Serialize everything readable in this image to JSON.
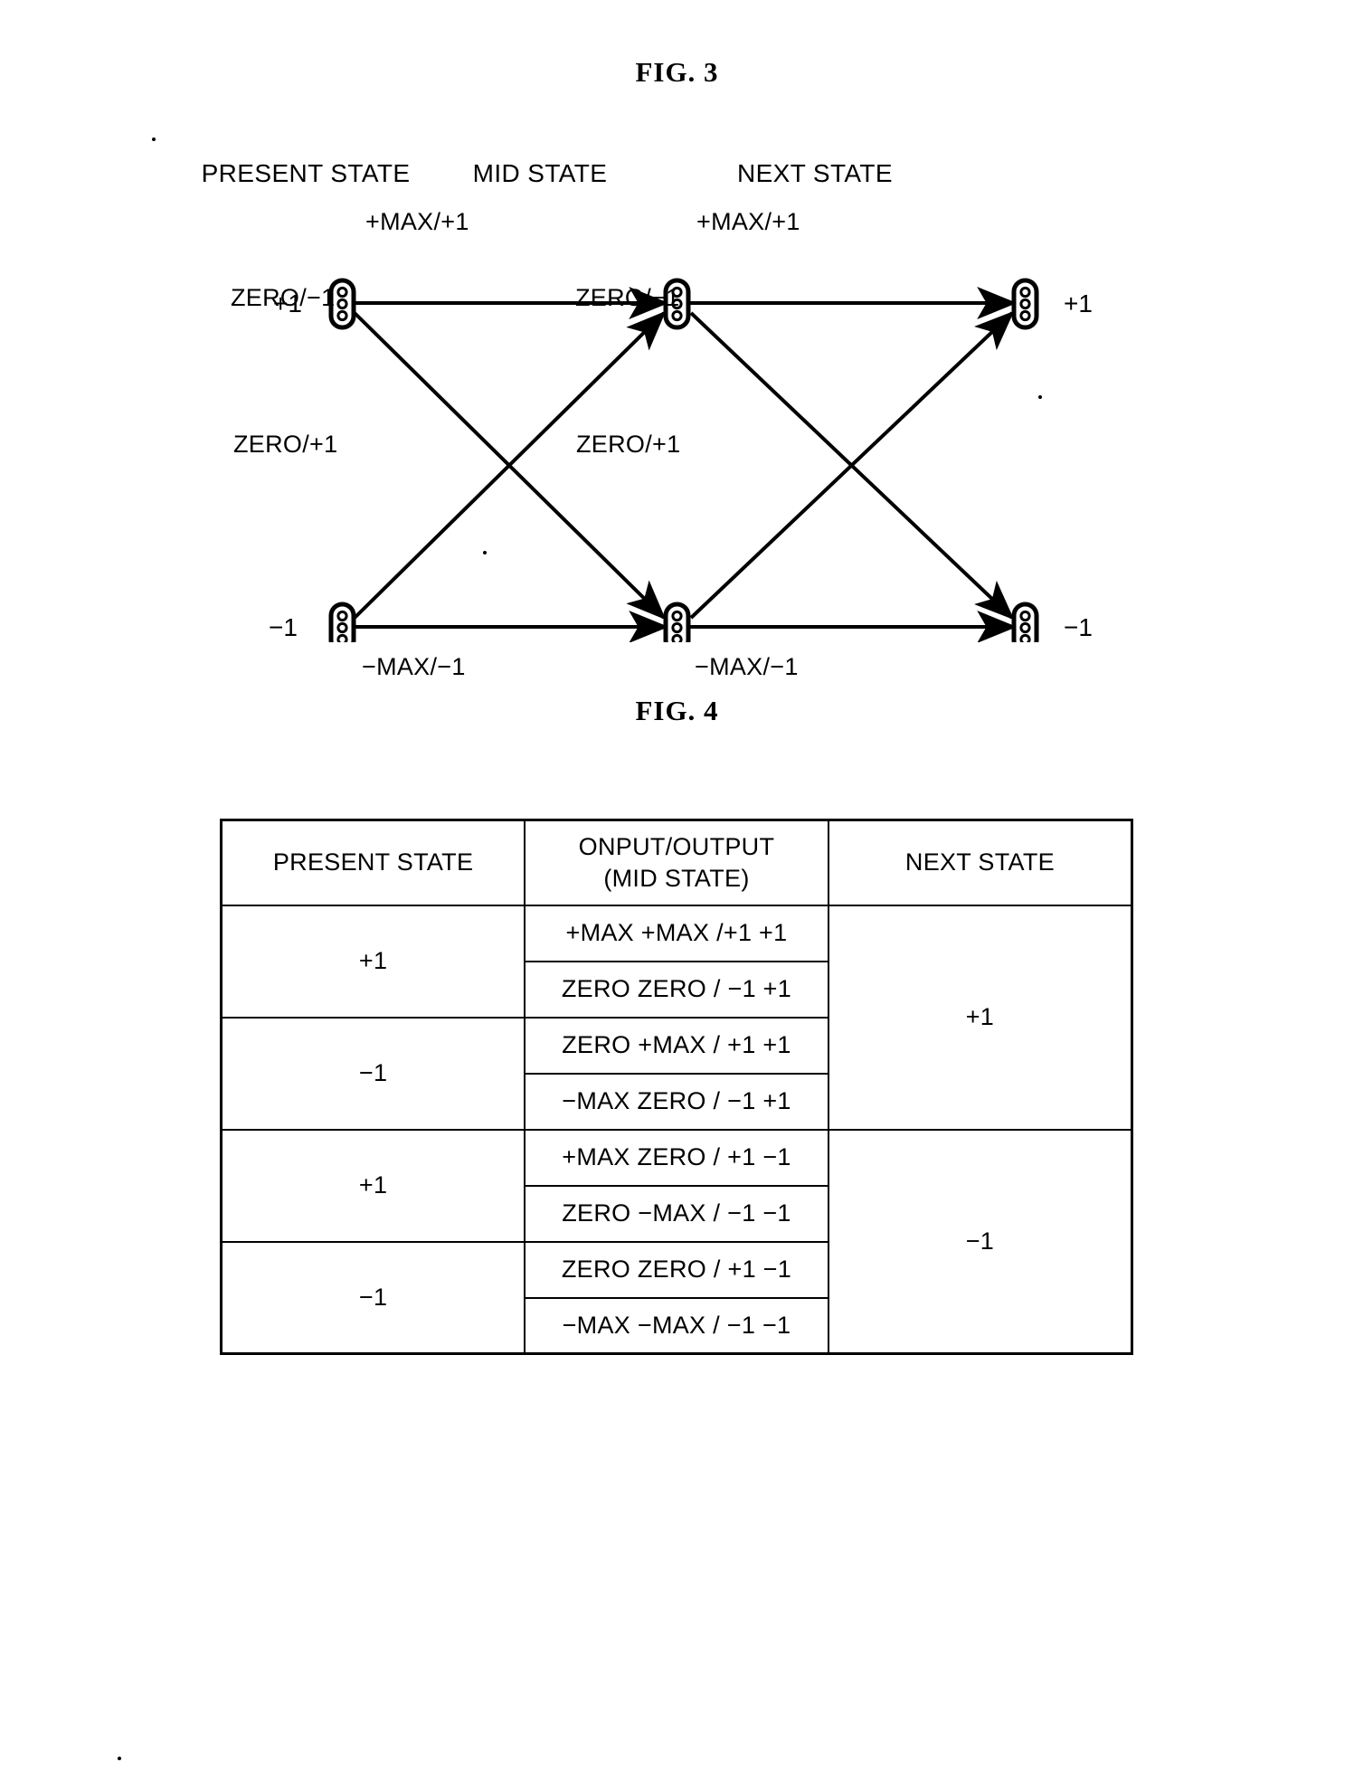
{
  "figures": {
    "fig3": {
      "caption": "FIG.  3",
      "column_headers": [
        {
          "label": "PRESENT STATE"
        },
        {
          "label": "MID STATE"
        },
        {
          "label": "NEXT STATE"
        }
      ],
      "node_labels": {
        "left_top": "+1",
        "left_bottom": "−1",
        "right_top": "+1",
        "right_bottom": "−1"
      },
      "edge_labels": {
        "stage1_top": "+MAX/+1",
        "stage1_cross_down": "ZERO/−1",
        "stage1_cross_up": "ZERO/+1",
        "stage1_bottom": "−MAX/−1",
        "stage2_top": "+MAX/+1",
        "stage2_cross_down": "ZERO/−1",
        "stage2_cross_up": "ZERO/+1",
        "stage2_bottom": "−MAX/−1"
      },
      "node_glyph": "state-node-icon"
    },
    "fig4": {
      "caption": "FIG.  4",
      "table": {
        "headers": [
          "PRESENT STATE",
          {
            "line1": "ONPUT/OUTPUT",
            "line2": "(MID STATE)"
          },
          "NEXT STATE"
        ],
        "groups": [
          {
            "next_state": "+1",
            "blocks": [
              {
                "present_state": "+1",
                "rows": [
                  {
                    "io": "+MAX +MAX /+1 +1",
                    "shaded": false
                  },
                  {
                    "io": "ZERO ZERO / −1 +1",
                    "shaded": true
                  }
                ]
              },
              {
                "present_state": "−1",
                "rows": [
                  {
                    "io": "ZERO +MAX / +1 +1",
                    "shaded": false
                  },
                  {
                    "io": "−MAX ZERO / −1 +1",
                    "shaded": false
                  }
                ]
              }
            ]
          },
          {
            "next_state": "−1",
            "blocks": [
              {
                "present_state": "+1",
                "rows": [
                  {
                    "io": "+MAX ZERO / +1 −1",
                    "shaded": false
                  },
                  {
                    "io": "ZERO −MAX / −1 −1",
                    "shaded": false
                  }
                ]
              },
              {
                "present_state": "−1",
                "rows": [
                  {
                    "io": "ZERO ZERO / +1 −1",
                    "shaded": true
                  },
                  {
                    "io": "−MAX −MAX / −1 −1",
                    "shaded": false
                  }
                ]
              }
            ]
          }
        ]
      }
    }
  },
  "colors": {
    "ink": "#000000",
    "paper": "#ffffff",
    "shade": "#d9d9d9"
  }
}
